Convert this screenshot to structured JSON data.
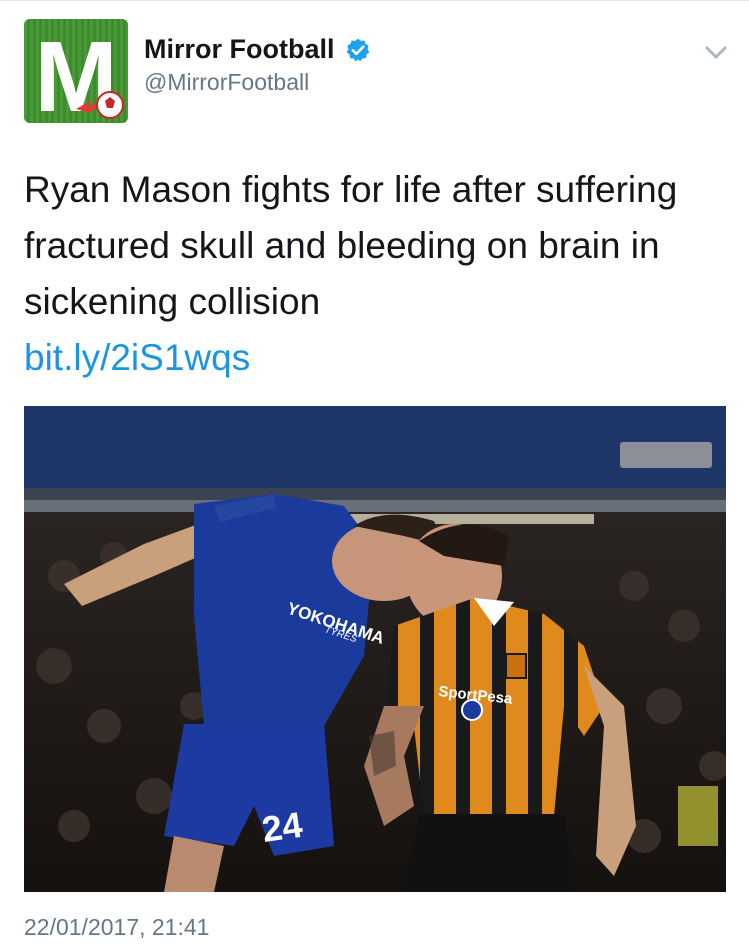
{
  "account": {
    "display_name": "Mirror Football",
    "handle": "@MirrorFootball",
    "verified": true,
    "avatar_letter": "M"
  },
  "tweet": {
    "text": "Ryan Mason fights for life after suffering fractured skull and bleeding on brain in sickening collision",
    "link": "bit.ly/2iS1wqs",
    "timestamp": "22/01/2017, 21:41"
  },
  "media": {
    "shirt_left_sponsor": "YOKOHAMA",
    "shirt_left_sponsor_sub": "TYRES",
    "shirt_left_number": "24",
    "shirt_right_sponsor": "SportPesa"
  },
  "icons": {
    "verified": "verified-badge-icon",
    "caret": "chevron-down-icon"
  },
  "colors": {
    "link": "#1b95e0",
    "verified": "#1da1f2",
    "secondary_text": "#657786",
    "primary_text": "#14171a"
  }
}
